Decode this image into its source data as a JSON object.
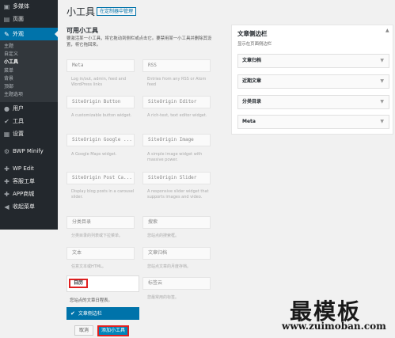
{
  "sidebar": {
    "items_top": [
      {
        "icon": "media-icon",
        "glyph": "▣",
        "label": "多媒体"
      },
      {
        "icon": "pages-icon",
        "glyph": "▤",
        "label": "页面"
      }
    ],
    "appearance": {
      "icon": "paintbrush-icon",
      "glyph": "✎",
      "label": "外观"
    },
    "sub_items": [
      "主题",
      "自定义",
      "小工具",
      "菜单",
      "背景",
      "顶部",
      "主题选项"
    ],
    "current_sub_index": 2,
    "items_bottom": [
      {
        "icon": "users-icon",
        "glyph": "●",
        "label": "用户"
      },
      {
        "icon": "tools-icon",
        "glyph": "✔",
        "label": "工具"
      },
      {
        "icon": "settings-icon",
        "glyph": "▦",
        "label": "设置"
      },
      {
        "icon": "bwp-minify-icon",
        "glyph": "⚙",
        "label": "BWP Minify"
      },
      {
        "icon": "wp-edit-icon",
        "glyph": "✚",
        "label": "WP Edit"
      },
      {
        "icon": "ticket-icon",
        "glyph": "✚",
        "label": "客服工单"
      },
      {
        "icon": "app-store-icon",
        "glyph": "✚",
        "label": "APP商城"
      },
      {
        "icon": "collapse-icon",
        "glyph": "◀",
        "label": "收起菜单"
      }
    ]
  },
  "header": {
    "title": "小工具",
    "manage_button": "在定制器中管理"
  },
  "available": {
    "title": "可用小工具",
    "description": "要激活某一小工具，将它拖动到侧栏或点击它。要禁用某一小工具并删除其设置，将它拖回来。",
    "widgets": [
      {
        "title": "Meta",
        "desc": "Log in/out, admin, feed and WordPress links"
      },
      {
        "title": "RSS",
        "desc": "Entries from any RSS or Atom feed"
      },
      {
        "title": "SiteOrigin Button",
        "desc": "A customizable button widget."
      },
      {
        "title": "SiteOrigin Editor",
        "desc": "A rich-text, text editor widget."
      },
      {
        "title": "SiteOrigin Google ...",
        "desc": "A Google Maps widget."
      },
      {
        "title": "SiteOrigin Image",
        "desc": "A simple image widget with massive power."
      },
      {
        "title": "SiteOrigin Post Ca...",
        "desc": "Display blog posts in a carousel slider."
      },
      {
        "title": "SiteOrigin Slider",
        "desc": "A responsive slider widget that supports images and video."
      },
      {
        "title": "分类目录",
        "desc": "分类目录的列表或下拉菜单。"
      },
      {
        "title": "搜索",
        "desc": "您站点的搜索框。"
      },
      {
        "title": "文本",
        "desc": "任意文本或HTML。"
      },
      {
        "title": "文章归档",
        "desc": "您站点文章的月度存档。"
      },
      {
        "title": "标签云",
        "desc": "您最常用的标签。"
      }
    ],
    "expanded": {
      "title": "日历",
      "desc": "您站点的文章日程表。",
      "sidebar_choice": "文章侧边栏",
      "cancel": "取消",
      "add": "添加小工具"
    }
  },
  "sidebar_panel": {
    "title": "文章侧边栏",
    "subtitle": "显示在页面侧边栏",
    "widgets": [
      "文章归档",
      "近期文章",
      "分类目录",
      "Meta"
    ]
  },
  "watermark": {
    "logo": "最模板",
    "url": "www.zuimoban.com"
  }
}
